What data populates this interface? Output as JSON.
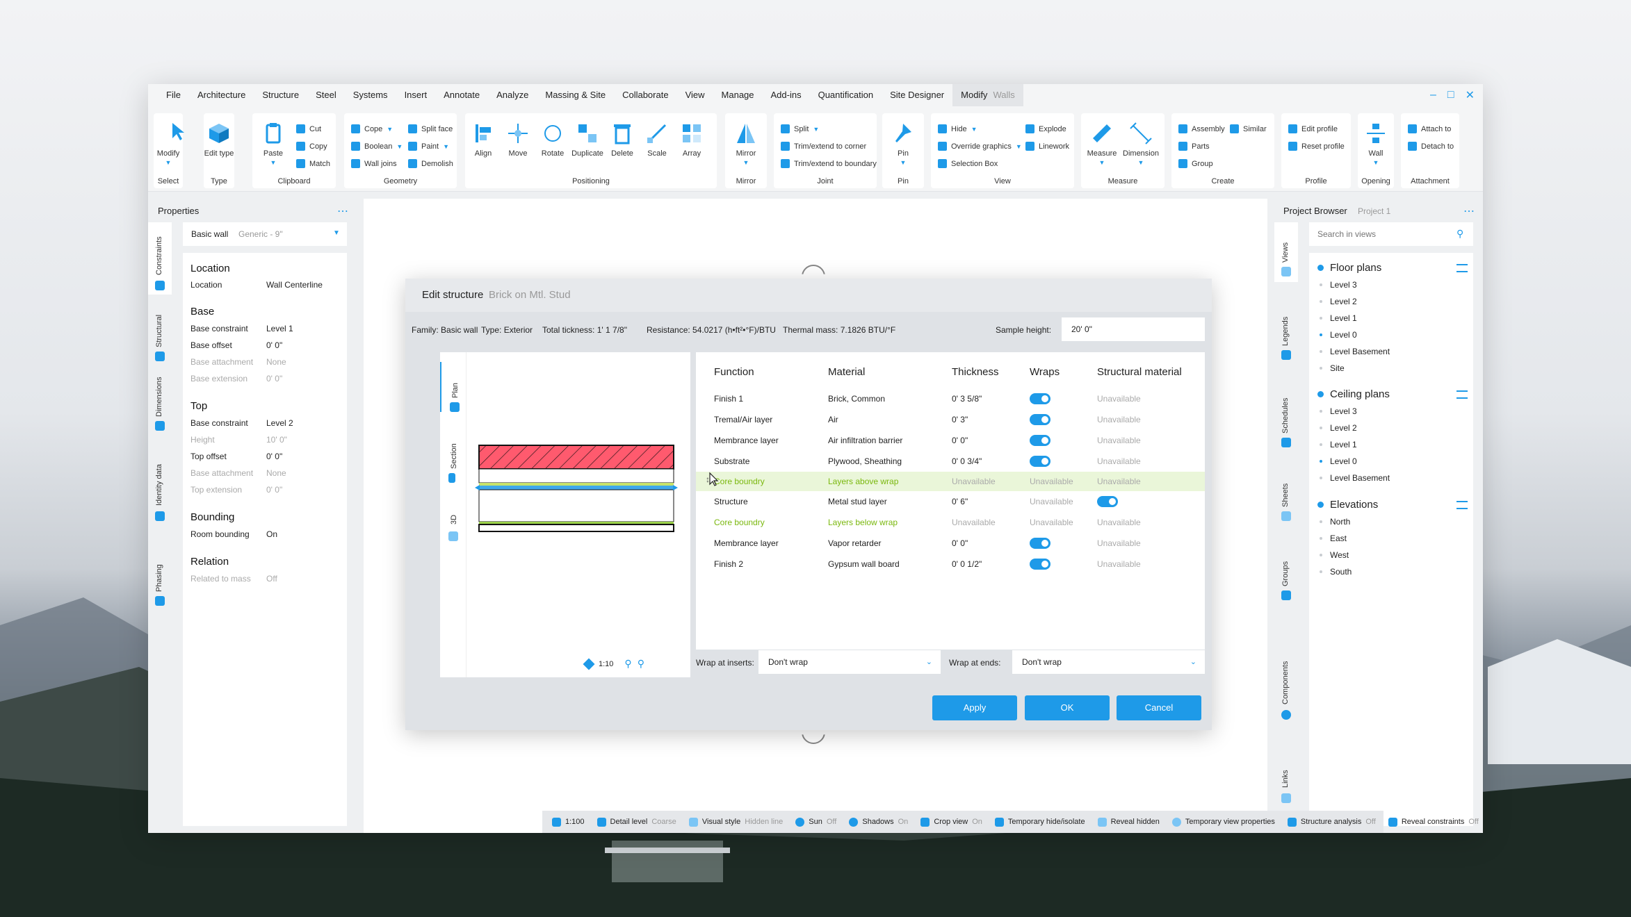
{
  "menubar": {
    "items": [
      "File",
      "Architecture",
      "Structure",
      "Steel",
      "Systems",
      "Insert",
      "Annotate",
      "Analyze",
      "Massing & Site",
      "Collaborate",
      "View",
      "Manage",
      "Add-ins",
      "Quantification",
      "Site Designer",
      "Modify"
    ],
    "context": "Walls"
  },
  "ribbon": {
    "select": {
      "modify": "Modify",
      "label": "Select"
    },
    "type": {
      "edit_type": "Edit type",
      "label": "Type"
    },
    "clipboard": {
      "paste": "Paste",
      "cut": "Cut",
      "copy": "Copy",
      "match": "Match",
      "label": "Clipboard"
    },
    "geometry": {
      "cope": "Cope",
      "boolean": "Boolean",
      "wall_joins": "Wall joins",
      "split_face": "Split face",
      "paint": "Paint",
      "demolish": "Demolish",
      "label": "Geometry"
    },
    "positioning": {
      "align": "Align",
      "move": "Move",
      "rotate": "Rotate",
      "duplicate": "Duplicate",
      "delete": "Delete",
      "scale": "Scale",
      "array": "Array",
      "label": "Positioning"
    },
    "mirror": {
      "mirror": "Mirror",
      "label": "Mirror"
    },
    "joint": {
      "split": "Split",
      "trim_corner": "Trim/extend to corner",
      "trim_boundary": "Trim/extend to boundary",
      "label": "Joint"
    },
    "pin": {
      "pin": "Pin",
      "label": "Pin"
    },
    "view": {
      "hide": "Hide",
      "override": "Override graphics",
      "selection_box": "Selection Box",
      "explode": "Explode",
      "linework": "Linework",
      "label": "View"
    },
    "measure": {
      "measure": "Measure",
      "dimension": "Dimension",
      "label": "Measure"
    },
    "create": {
      "assembly": "Assembly",
      "similar": "Similar",
      "parts": "Parts",
      "group": "Group",
      "label": "Create"
    },
    "profile": {
      "edit_profile": "Edit profile",
      "reset_profile": "Reset profile",
      "label": "Profile"
    },
    "opening": {
      "wall": "Wall",
      "label": "Opening"
    },
    "attachment": {
      "attach_to": "Attach to",
      "detach_to": "Detach to",
      "label": "Attachment"
    }
  },
  "properties": {
    "title": "Properties",
    "type_name": "Basic wall",
    "type_variant": "Generic - 9\"",
    "tabs": [
      "Constraints",
      "Structural",
      "Dimensions",
      "Identity data",
      "Phasing"
    ],
    "sections": {
      "location": "Location",
      "base": "Base",
      "top": "Top",
      "bounding": "Bounding",
      "relation": "Relation"
    },
    "rows": {
      "location": {
        "label": "Location",
        "value": "Wall Centerline"
      },
      "base_constraint": {
        "label": "Base constraint",
        "value": "Level 1"
      },
      "base_offset": {
        "label": "Base offset",
        "value": "0' 0\""
      },
      "base_attachment": {
        "label": "Base attachment",
        "value": "None"
      },
      "base_extension": {
        "label": "Base extension",
        "value": "0' 0\""
      },
      "top_constraint": {
        "label": "Base constraint",
        "value": "Level 2"
      },
      "height": {
        "label": "Height",
        "value": "10' 0\""
      },
      "top_offset": {
        "label": "Top offset",
        "value": "0' 0\""
      },
      "top_attachment": {
        "label": "Base attachment",
        "value": "None"
      },
      "top_extension": {
        "label": "Top extension",
        "value": "0' 0\""
      },
      "room_bounding": {
        "label": "Room bounding",
        "value": "On"
      },
      "related_to_mass": {
        "label": "Related to mass",
        "value": "Off"
      }
    }
  },
  "dialog": {
    "title": "Edit structure",
    "subtitle": "Brick on Mtl. Stud",
    "info": {
      "family_label": "Family:",
      "family": "Basic wall",
      "type_label": "Type:",
      "type": "Exterior",
      "thickness_label": "Total tickness:",
      "thickness": "1' 1 7/8\"",
      "resistance_label": "Resistance:",
      "resistance": "54.0217 (h•ft²•°F)/BTU",
      "mass_label": "Thermal mass:",
      "mass": "7.1826 BTU/°F",
      "sample_label": "Sample height:",
      "sample": "20' 0\""
    },
    "view_tabs": [
      "Plan",
      "Section",
      "3D"
    ],
    "scale": "1:10",
    "columns": [
      "Function",
      "Material",
      "Thickness",
      "Wraps",
      "Structural material"
    ],
    "rows": [
      {
        "function": "Finish 1",
        "material": "Brick, Common",
        "thickness": "0' 3 5/8\"",
        "wraps": "toggle",
        "structural": "Unavailable"
      },
      {
        "function": "Tremal/Air layer",
        "material": "Air",
        "thickness": "0' 3\"",
        "wraps": "toggle",
        "structural": "Unavailable"
      },
      {
        "function": "Membrance layer",
        "material": "Air infiltration barrier",
        "thickness": "0' 0\"",
        "wraps": "toggle",
        "structural": "Unavailable"
      },
      {
        "function": "Substrate",
        "material": "Plywood, Sheathing",
        "thickness": "0' 0 3/4\"",
        "wraps": "toggle",
        "structural": "Unavailable"
      },
      {
        "function": "Core boundry",
        "material": "Layers above wrap",
        "thickness": "Unavailable",
        "wraps": "Unavailable",
        "structural": "Unavailable"
      },
      {
        "function": "Structure",
        "material": "Metal stud layer",
        "thickness": "0' 6\"",
        "wraps": "Unavailable",
        "structural": "toggle"
      },
      {
        "function": "Core boundry",
        "material": "Layers below wrap",
        "thickness": "Unavailable",
        "wraps": "Unavailable",
        "structural": "Unavailable"
      },
      {
        "function": "Membrance layer",
        "material": "Vapor retarder",
        "thickness": "0' 0\"",
        "wraps": "toggle",
        "structural": "Unavailable"
      },
      {
        "function": "Finish 2",
        "material": "Gypsum wall board",
        "thickness": "0' 0 1/2\"",
        "wraps": "toggle",
        "structural": "Unavailable"
      }
    ],
    "wrap_inserts_label": "Wrap at inserts:",
    "wrap_inserts_value": "Don't wrap",
    "wrap_ends_label": "Wrap at ends:",
    "wrap_ends_value": "Don't wrap",
    "apply": "Apply",
    "ok": "OK",
    "cancel": "Cancel"
  },
  "browser": {
    "title": "Project Browser",
    "project": "Project 1",
    "search_placeholder": "Search in views",
    "tabs": [
      "Views",
      "Legends",
      "Schedules",
      "Sheets",
      "Groups",
      "Components",
      "Links"
    ],
    "floor_plans": {
      "title": "Floor plans",
      "items": [
        "Level 3",
        "Level 2",
        "Level 1",
        "Level 0",
        "Level Basement",
        "Site"
      ]
    },
    "ceiling_plans": {
      "title": "Ceiling plans",
      "items": [
        "Level 3",
        "Level 2",
        "Level 1",
        "Level 0",
        "Level Basement"
      ]
    },
    "elevations": {
      "title": "Elevations",
      "items": [
        "North",
        "East",
        "West",
        "South"
      ]
    }
  },
  "status": {
    "scale": "1:100",
    "detail_label": "Detail level",
    "detail_value": "Coarse",
    "visual_label": "Visual style",
    "visual_value": "Hidden line",
    "sun_label": "Sun",
    "sun_value": "Off",
    "shadows_label": "Shadows",
    "shadows_value": "On",
    "crop_label": "Crop view",
    "crop_value": "On",
    "temp_hide": "Temporary hide/isolate",
    "reveal_hidden": "Reveal hidden",
    "temp_view": "Temporary view properties",
    "struct_label": "Structure analysis",
    "struct_value": "Off",
    "reveal_constraints_label": "Reveal constraints",
    "reveal_constraints_value": "Off"
  },
  "colors": {
    "accent": "#1e9ae8",
    "core_green": "#7ab80e",
    "highlight_row": "#eaf6d9",
    "finish_red": "#ff5a6e"
  }
}
